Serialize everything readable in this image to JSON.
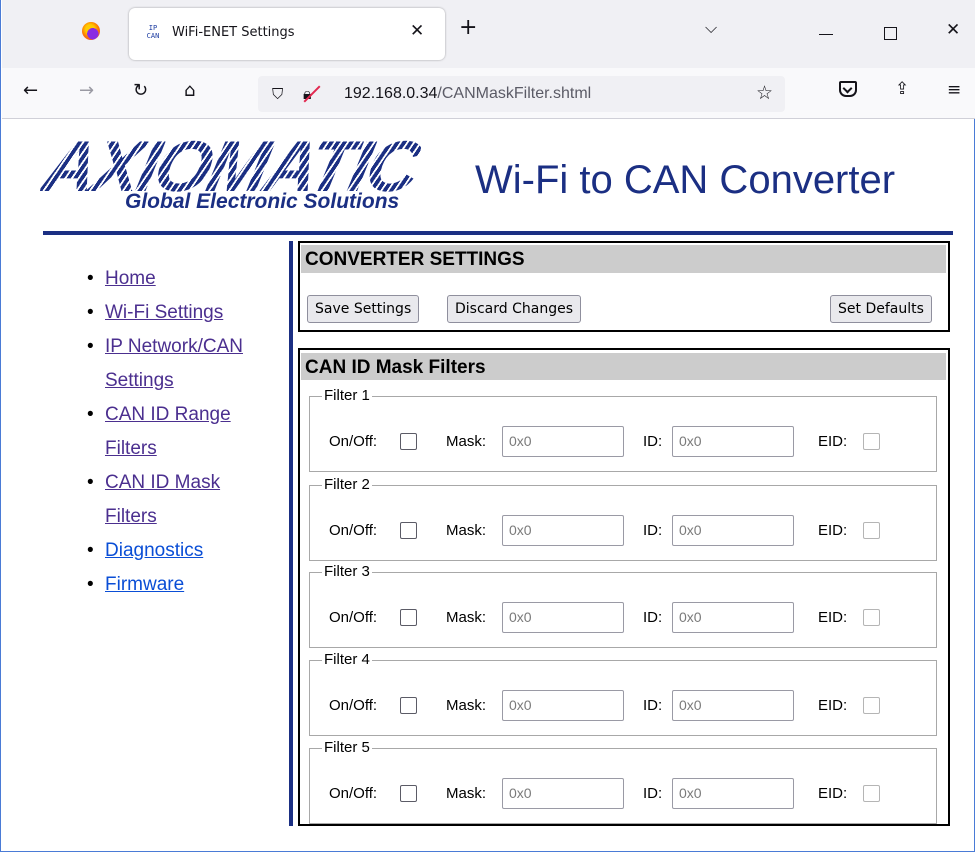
{
  "browser": {
    "tab_title": "WiFi-ENET Settings",
    "tab_icon_top": "IP",
    "tab_icon_bottom": "CAN",
    "url_host": "192.168.0.34",
    "url_path": "/CANMaskFilter.shtml"
  },
  "header": {
    "logo_text": "AXIOMATIC",
    "logo_tagline": "Global Electronic Solutions",
    "title": "Wi-Fi to CAN Converter"
  },
  "sidebar": {
    "items": [
      {
        "label": "Home",
        "visited": true
      },
      {
        "label": "Wi-Fi Settings",
        "visited": true
      },
      {
        "label": "IP Network/CAN Settings",
        "visited": true
      },
      {
        "label": "CAN ID Range Filters",
        "visited": true
      },
      {
        "label": "CAN ID Mask Filters",
        "visited": true
      },
      {
        "label": "Diagnostics",
        "visited": false
      },
      {
        "label": "Firmware",
        "visited": false
      }
    ]
  },
  "converter_settings": {
    "heading": "CONVERTER SETTINGS",
    "save_label": "Save Settings",
    "discard_label": "Discard Changes",
    "defaults_label": "Set Defaults"
  },
  "mask_filters": {
    "heading": "CAN ID Mask Filters",
    "onoff_label": "On/Off:",
    "mask_label": "Mask:",
    "id_label": "ID:",
    "eid_label": "EID:",
    "filters": [
      {
        "legend": "Filter 1",
        "on": false,
        "mask_placeholder": "0x0",
        "id_placeholder": "0x0",
        "eid": false
      },
      {
        "legend": "Filter 2",
        "on": false,
        "mask_placeholder": "0x0",
        "id_placeholder": "0x0",
        "eid": false
      },
      {
        "legend": "Filter 3",
        "on": false,
        "mask_placeholder": "0x0",
        "id_placeholder": "0x0",
        "eid": false
      },
      {
        "legend": "Filter 4",
        "on": false,
        "mask_placeholder": "0x0",
        "id_placeholder": "0x0",
        "eid": false
      },
      {
        "legend": "Filter 5",
        "on": false,
        "mask_placeholder": "0x0",
        "id_placeholder": "0x0",
        "eid": false
      }
    ]
  },
  "colors": {
    "brand_navy": "#1b2f83",
    "visited_link": "#4b2f8f",
    "link": "#0a4ed6",
    "section_header_bg": "#cccccc"
  }
}
